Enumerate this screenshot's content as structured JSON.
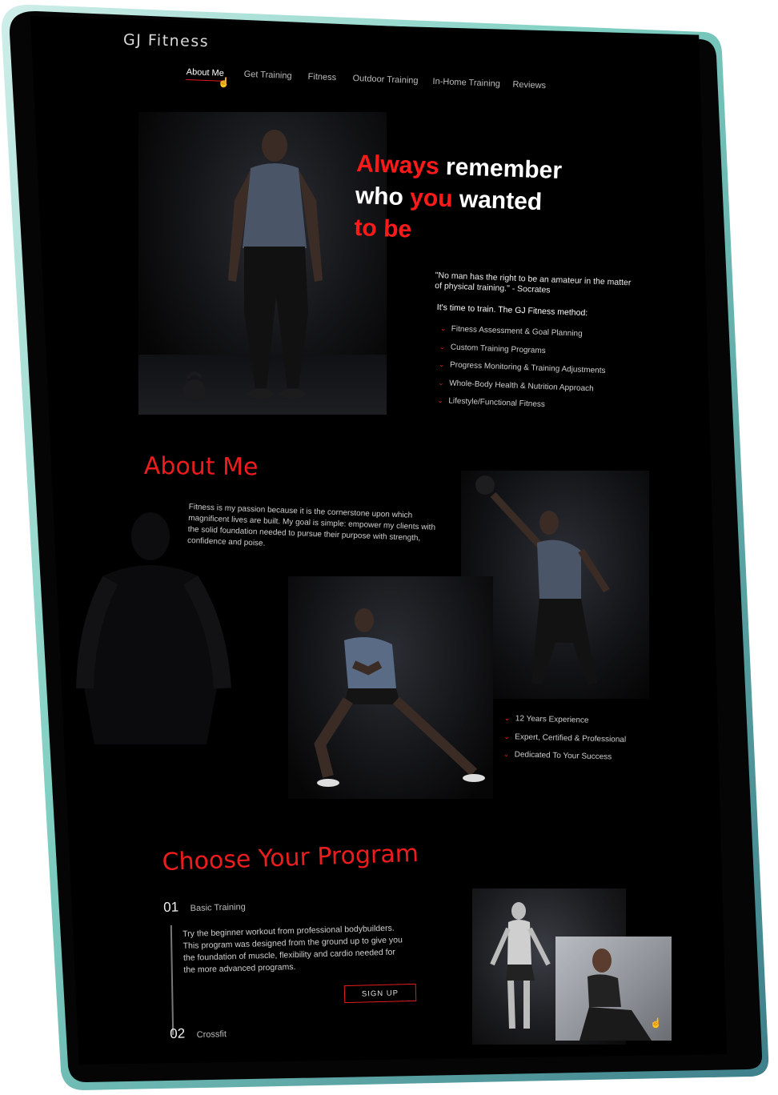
{
  "brand": "GJ Fitness",
  "nav": {
    "items": [
      "About Me",
      "Get Training",
      "Fitness",
      "Outdoor Training",
      "In-Home Training",
      "Reviews"
    ],
    "active": "About Me"
  },
  "hero": {
    "line1_red": "Always",
    "line1_white": "remember",
    "line2_white_a": "who",
    "line2_red": "you",
    "line2_white_b": "wanted",
    "line3_red": "to be",
    "quote": "\"No man has the right to be an amateur in the matter of physical training.\" - Socrates",
    "method_heading": "It's time to train. The GJ Fitness method:",
    "method_items": [
      "Fitness Assessment & Goal Planning",
      "Custom Training Programs",
      "Progress Monitoring & Training Adjustments",
      "Whole-Body Health & Nutrition Approach",
      "Lifestyle/Functional Fitness"
    ]
  },
  "about": {
    "title": "About Me",
    "body": "Fitness is my passion because it is the cornerstone upon which magnificent lives are built. My goal is simple: empower my clients with the solid foundation needed to pursue their purpose with strength, confidence and poise.",
    "highlights": [
      "12 Years Experience",
      "Expert, Certified & Professional",
      "Dedicated To Your Success"
    ]
  },
  "programs": {
    "title": "Choose Your Program",
    "items": [
      {
        "num": "01",
        "name": "Basic Training",
        "desc": "Try the beginner workout from professional bodybuilders. This program was designed from the ground up to give you the foundation of muscle, flexibility and cardio needed for the more advanced programs."
      },
      {
        "num": "02",
        "name": "Crossfit"
      }
    ],
    "signup_label": "SIGN UP"
  },
  "colors": {
    "accent": "#e51b1b",
    "background": "#000000",
    "frame": "#8fd6c9"
  }
}
